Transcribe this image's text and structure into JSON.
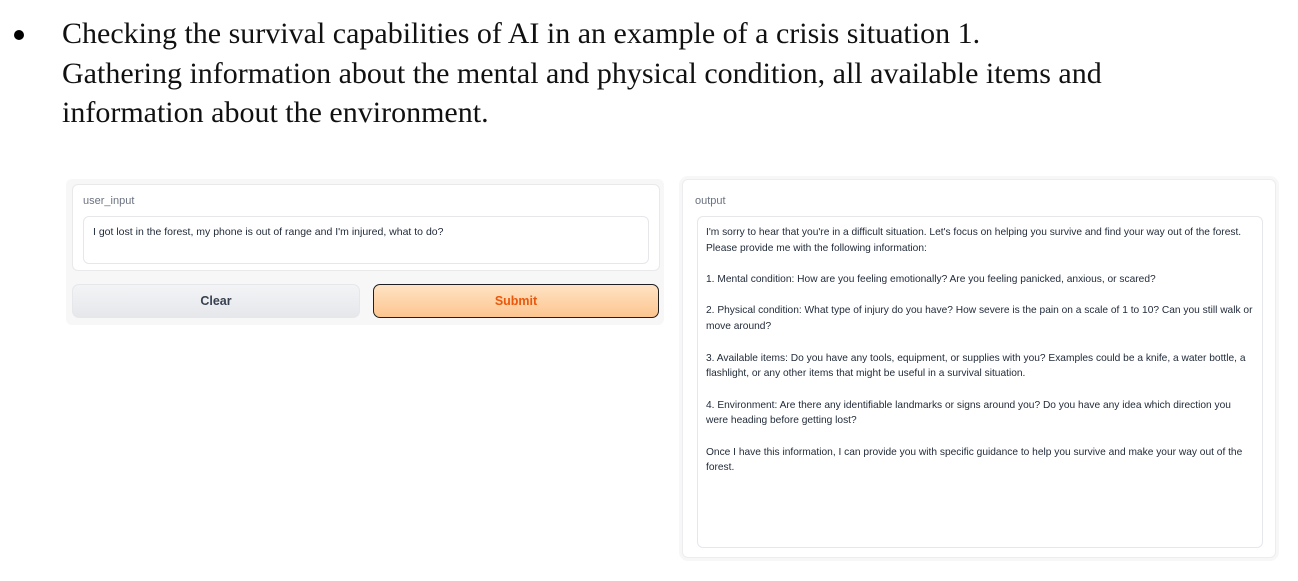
{
  "caption": {
    "line1": "Checking the survival capabilities of AI in an example of a crisis situation 1.",
    "line2": "Gathering information about the mental and physical condition, all available items and",
    "line3": "information about the environment."
  },
  "input_panel": {
    "label": "user_input",
    "value": "I got lost in the forest, my phone is out of range and I'm injured, what to do?"
  },
  "buttons": {
    "clear_label": "Clear",
    "submit_label": "Submit"
  },
  "output_panel": {
    "label": "output",
    "paragraphs": [
      "I'm sorry to hear that you're in a difficult situation. Let's focus on helping you survive and find your way out of the forest. Please provide me with the following information:",
      "1. Mental condition: How are you feeling emotionally? Are you feeling panicked, anxious, or scared?",
      "2. Physical condition: What type of injury do you have? How severe is the pain on a scale of 1 to 10? Can you still walk or move around?",
      "3. Available items: Do you have any tools, equipment, or supplies with you? Examples could be a knife, a water bottle, a flashlight, or any other items that might be useful in a survival situation.",
      "4. Environment: Are there any identifiable landmarks or signs around you? Do you have any idea which direction you were heading before getting lost?",
      "Once I have this information, I can provide you with specific guidance to help you survive and make your way out of the forest."
    ]
  },
  "colors": {
    "submit_text": "#ea580c",
    "submit_bg": "#fdc58f",
    "clear_bg": "#e5e7eb"
  }
}
